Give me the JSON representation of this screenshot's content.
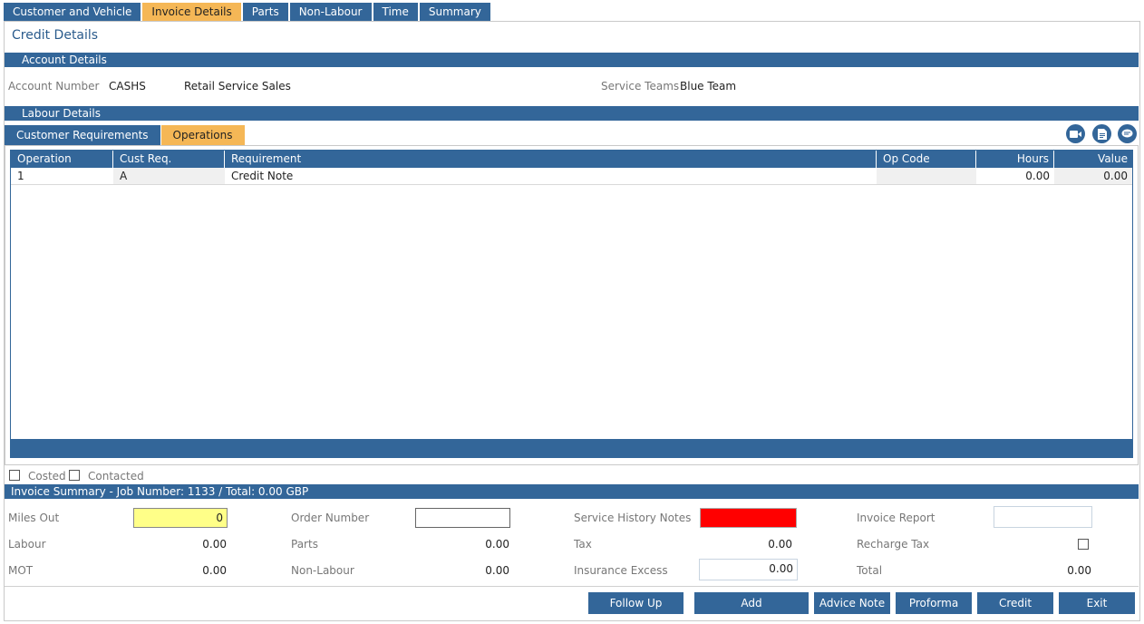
{
  "top_tabs": [
    "Customer and Vehicle",
    "Invoice Details",
    "Parts",
    "Non-Labour",
    "Time",
    "Summary"
  ],
  "page_title": "Credit Details",
  "account_section": {
    "title": "Account Details",
    "account_number_label": "Account Number",
    "account_number": "CASHS",
    "account_name": "Retail Service Sales",
    "service_teams_label": "Service Teams",
    "service_teams": "Blue Team"
  },
  "labour_section": {
    "title": "Labour Details",
    "sub_tabs": [
      "Customer Requirements",
      "Operations"
    ]
  },
  "operations_grid": {
    "columns": [
      "Operation",
      "Cust Req.",
      "Requirement",
      "Op Code",
      "Hours",
      "Value"
    ],
    "rows": [
      {
        "operation": "1",
        "cust_req": "A",
        "requirement": "Credit Note",
        "op_code": "",
        "hours": "0.00",
        "value": "0.00"
      }
    ]
  },
  "flags": {
    "costed": "Costed",
    "contacted": "Contacted"
  },
  "invoice_summary": {
    "title": "Invoice Summary - Job Number: 1133 / Total: 0.00 GBP",
    "miles_out_label": "Miles Out",
    "miles_out": "0",
    "order_number_label": "Order Number",
    "order_number": "",
    "service_history_label": "Service History Notes",
    "invoice_report_label": "Invoice Report",
    "labour_label": "Labour",
    "labour": "0.00",
    "parts_label": "Parts",
    "parts": "0.00",
    "tax_label": "Tax",
    "tax": "0.00",
    "recharge_tax_label": "Recharge Tax",
    "mot_label": "MOT",
    "mot": "0.00",
    "non_labour_label": "Non-Labour",
    "non_labour": "0.00",
    "insurance_excess_label": "Insurance Excess",
    "insurance_excess": "0.00",
    "total_label": "Total",
    "total": "0.00"
  },
  "buttons": {
    "follow_up": "Follow Up",
    "add": "Add",
    "advice_note": "Advice Note",
    "proforma": "Proforma",
    "credit": "Credit",
    "exit": "Exit"
  },
  "colors": {
    "primary": "#336699",
    "active_tab": "#f5b756",
    "miles_field": "#ffff88",
    "service_history_flag": "#ff0000"
  },
  "icons": [
    "video-icon",
    "document-icon",
    "chat-icon"
  ]
}
